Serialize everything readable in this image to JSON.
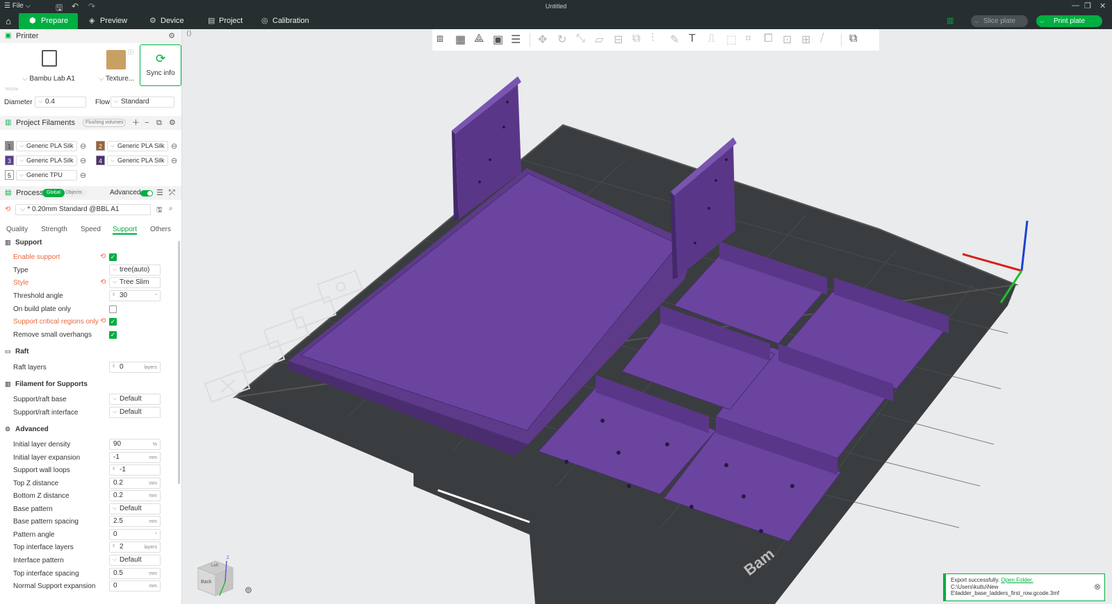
{
  "titlebar": {
    "file_label": "File",
    "title": "Untitled"
  },
  "topbar": {
    "tabs": [
      {
        "label": "Prepare",
        "icon": "prepare-icon"
      },
      {
        "label": "Preview",
        "icon": "preview-icon"
      },
      {
        "label": "Device",
        "icon": "device-icon"
      },
      {
        "label": "Project",
        "icon": "project-icon"
      },
      {
        "label": "Calibration",
        "icon": "calibration-icon"
      }
    ],
    "slice_label": "Slice plate",
    "print_label": "Print plate"
  },
  "printer": {
    "section_title": "Printer",
    "printer_name": "Bambu Lab A1",
    "plate_name": "Texture...",
    "sync_label": "Sync info",
    "nozzle_label": "Nozzle",
    "diameter_label": "Diameter",
    "diameter_value": "0.4",
    "flow_label": "Flow",
    "flow_value": "Standard"
  },
  "filaments": {
    "section_title": "Project Filaments",
    "flushing_label": "Flushing volumes",
    "items": [
      {
        "num": "1",
        "name": "Generic PLA Silk",
        "color": "#8c8c8c"
      },
      {
        "num": "2",
        "name": "Generic PLA Silk",
        "color": "#a0622d"
      },
      {
        "num": "3",
        "name": "Generic PLA Silk",
        "color": "#5b3d91"
      },
      {
        "num": "4",
        "name": "Generic PLA Silk",
        "color": "#4e2f73"
      },
      {
        "num": "5",
        "name": "Generic TPU",
        "color": "#ffffff"
      }
    ]
  },
  "process": {
    "section_title": "Process",
    "global_label": "Global",
    "objects_label": "Objects",
    "advanced_label": "Advanced",
    "preset": "* 0.20mm Standard @BBL A1",
    "tabs": [
      "Quality",
      "Strength",
      "Speed",
      "Support",
      "Others"
    ],
    "active_tab": "Support"
  },
  "support": {
    "group_support": "Support",
    "enable_support": "Enable support",
    "type_label": "Type",
    "type_value": "tree(auto)",
    "style_label": "Style",
    "style_value": "Tree Slim",
    "threshold_label": "Threshold angle",
    "threshold_value": "30",
    "threshold_unit": "°",
    "build_plate_only": "On build plate only",
    "critical_regions": "Support critical regions only",
    "remove_small": "Remove small overhangs",
    "group_raft": "Raft",
    "raft_layers_label": "Raft layers",
    "raft_layers_value": "0",
    "unit_layers": "layers",
    "group_filament": "Filament for Supports",
    "raft_base_label": "Support/raft base",
    "raft_base_value": "Default",
    "raft_interface_label": "Support/raft interface",
    "raft_interface_value": "Default",
    "group_advanced": "Advanced",
    "init_density_label": "Initial layer density",
    "init_density_value": "90",
    "unit_percent": "%",
    "init_expansion_label": "Initial layer expansion",
    "init_expansion_value": "-1",
    "unit_mm": "mm",
    "wall_loops_label": "Support wall loops",
    "wall_loops_value": "-1",
    "top_z_label": "Top Z distance",
    "top_z_value": "0.2",
    "bottom_z_label": "Bottom Z distance",
    "bottom_z_value": "0.2",
    "base_pattern_label": "Base pattern",
    "base_pattern_value": "Default",
    "base_spacing_label": "Base pattern spacing",
    "base_spacing_value": "2.5",
    "pattern_angle_label": "Pattern angle",
    "pattern_angle_value": "0",
    "top_iface_layers_label": "Top interface layers",
    "top_iface_layers_value": "2",
    "iface_pattern_label": "Interface pattern",
    "iface_pattern_value": "Default",
    "top_iface_spacing_label": "Top interface spacing",
    "top_iface_spacing_value": "0.5",
    "normal_expansion_label": "Normal Support expansion",
    "normal_expansion_value": "0"
  },
  "toast": {
    "message": "Export successfully.",
    "link": "Open Folder.",
    "path": "C:\\Users\\kutlu\\New E\\ladder_base_ladders_first_row.gcode.3mf"
  },
  "navcube": {
    "front_label": "Back",
    "top_label": "Left",
    "z_label": "Z"
  },
  "plate_brand": "Bam"
}
